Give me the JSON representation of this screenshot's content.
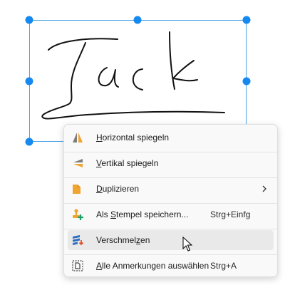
{
  "selection": {
    "content": "Jack",
    "content_kind": "handwritten-signature",
    "color": "#1689f0"
  },
  "context_menu": {
    "items": [
      {
        "label": "Horizontal spiegeln",
        "mnemonic": "H",
        "icon": "flip-horizontal-icon"
      },
      {
        "label": "Vertikal spiegeln",
        "mnemonic": "V",
        "icon": "flip-vertical-icon"
      },
      {
        "label": "Duplizieren",
        "mnemonic": "D",
        "icon": "duplicate-icon",
        "submenu": true
      },
      {
        "label": "Als Stempel speichern...",
        "mnemonic": "S",
        "shortcut": "Strg+Einfg",
        "icon": "save-stamp-icon"
      },
      {
        "label": "Verschmelzen",
        "mnemonic": "z",
        "icon": "merge-layers-icon",
        "hovered": true
      },
      {
        "label": "Alle Anmerkungen auswählen",
        "mnemonic": "A",
        "shortcut": "Strg+A",
        "icon": "select-all-icon"
      }
    ]
  }
}
